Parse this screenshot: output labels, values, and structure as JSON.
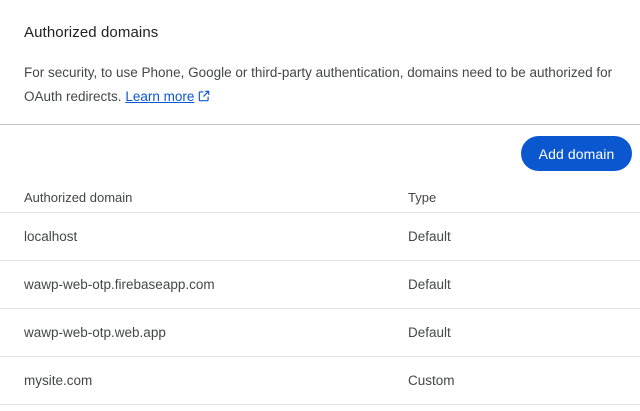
{
  "section": {
    "title": "Authorized domains",
    "description": "For security, to use Phone, Google or third-party authentication, domains need to be authorized for OAuth redirects.",
    "learn_more_label": "Learn more",
    "learn_more_icon": "open-in-new-icon"
  },
  "toolbar": {
    "add_domain_label": "Add domain"
  },
  "table": {
    "columns": [
      "Authorized domain",
      "Type"
    ],
    "rows": [
      {
        "domain": "localhost",
        "type": "Default"
      },
      {
        "domain": "wawp-web-otp.firebaseapp.com",
        "type": "Default"
      },
      {
        "domain": "wawp-web-otp.web.app",
        "type": "Default"
      },
      {
        "domain": "mysite.com",
        "type": "Custom"
      }
    ]
  },
  "colors": {
    "accent": "#0b57d0",
    "text": "#1f1f1f",
    "secondary_text": "#444746",
    "divider": "#c4c7c5"
  }
}
